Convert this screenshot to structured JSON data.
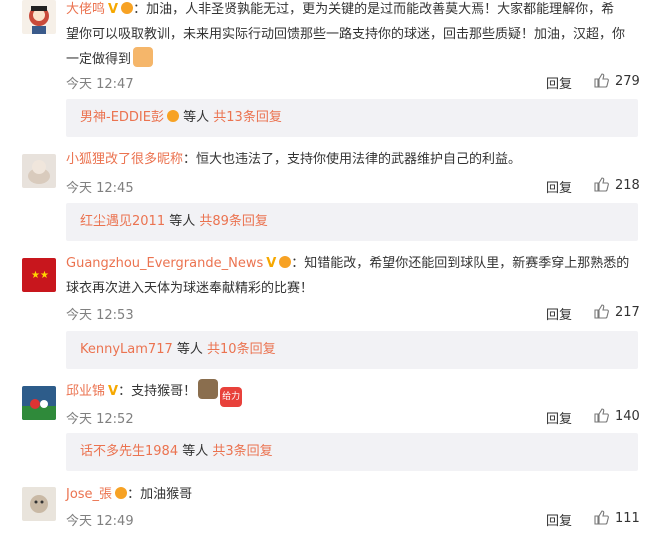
{
  "comments": [
    {
      "user": "大佬鸣",
      "text_line1": "：加油，人非圣贤孰能无过，更为关键的是过而能改善莫大焉！大家都能理解你，希",
      "text_line2": "望你可以吸取教训，未来用实际行动回馈那些一路支持你的球迷，回击那些质疑！加油，汉超，你",
      "text_line3": "一定做得到",
      "time": "今天 12:47",
      "reply": "回复",
      "likes": "279",
      "sub_user": "男神-EDDIE彭",
      "sub_mid": "等人",
      "sub_count": "共13条回复"
    },
    {
      "user": "小狐狸改了很多昵称",
      "text_line1": "：恒大也违法了，支持你使用法律的武器维护自己的利益。",
      "time": "今天 12:45",
      "reply": "回复",
      "likes": "218",
      "sub_user": "红尘遇见2011",
      "sub_mid": "等人",
      "sub_count": "共89条回复"
    },
    {
      "user": "Guangzhou_Evergrande_News",
      "text_line1": "：知错能改，希望你还能回到球队里，新赛季穿上那熟悉的",
      "text_line2": "球衣再次进入天体为球迷奉献精彩的比赛！",
      "time": "今天 12:53",
      "reply": "回复",
      "likes": "217",
      "sub_user": "KennyLam717",
      "sub_mid": "等人",
      "sub_count": "共10条回复"
    },
    {
      "user": "邱业锦",
      "text_line1": "：支持猴哥！",
      "time": "今天 12:52",
      "reply": "回复",
      "likes": "140",
      "sub_user": "话不多先生1984",
      "sub_mid": "等人",
      "sub_count": "共3条回复"
    },
    {
      "user": "Jose_張",
      "text_line1": "：加油猴哥",
      "time": "今天 12:49",
      "reply": "回复",
      "likes": "111"
    }
  ],
  "emoji_badge": "给力",
  "colors": {
    "accent": "#eb7350",
    "vip": "#f6a800",
    "subbox": "#f2f2f5"
  }
}
